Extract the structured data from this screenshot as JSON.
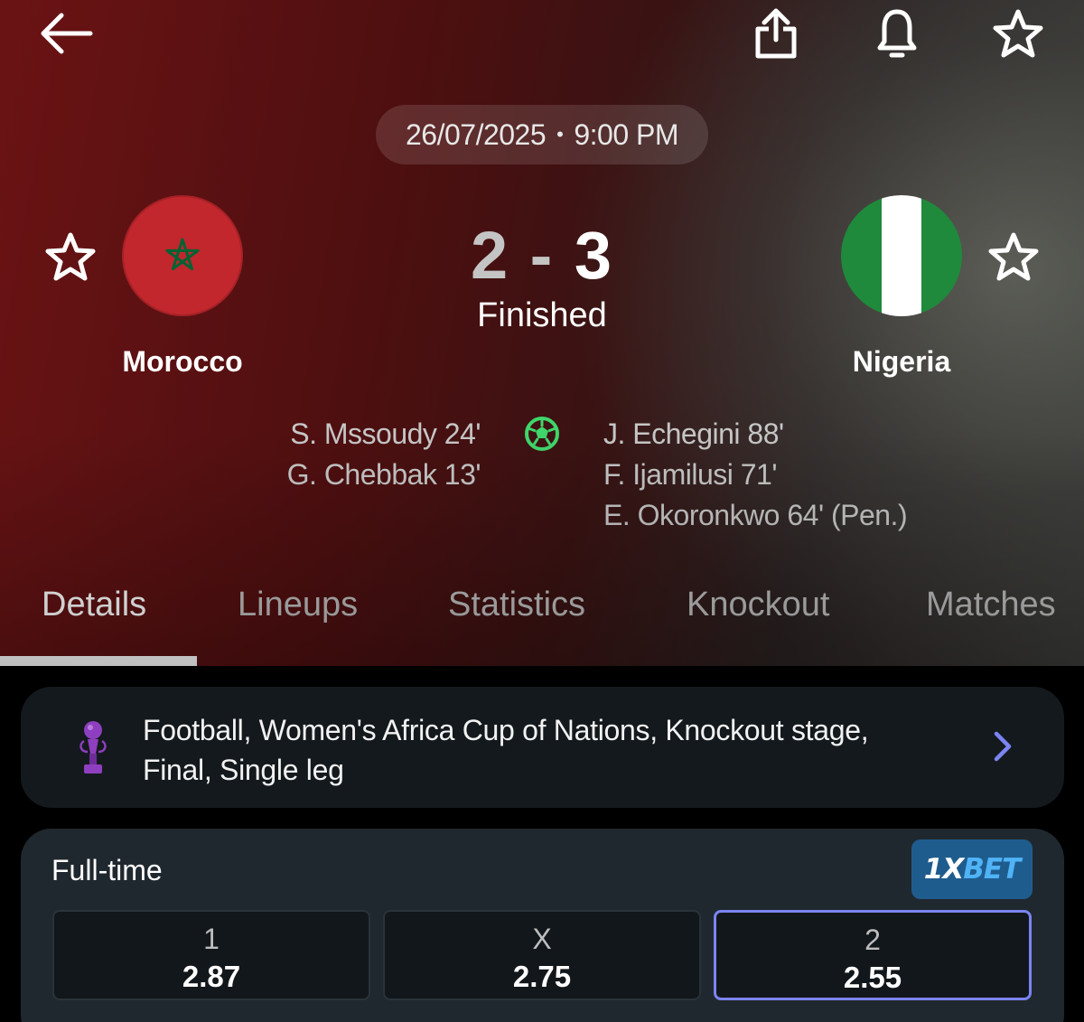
{
  "match": {
    "datetime": "26/07/2025",
    "time": "9:00 PM",
    "separator": "•",
    "home_team": "Morocco",
    "away_team": "Nigeria",
    "home_score": "2",
    "score_separator": "-",
    "away_score": "3",
    "status": "Finished",
    "home_scorers": [
      "S. Mssoudy 24'",
      "G. Chebbak 13'"
    ],
    "away_scorers": [
      "J. Echegini 88'",
      "F. Ijamilusi 71'",
      "E. Okoronkwo 64' (Pen.)"
    ]
  },
  "tabs": [
    "Details",
    "Lineups",
    "Statistics",
    "Knockout",
    "Matches"
  ],
  "active_tab": "Details",
  "competition": {
    "line1": "Football, Women's Africa Cup of Nations, Knockout stage,",
    "line2": "Final, Single leg"
  },
  "odds": {
    "title": "Full-time",
    "bookmaker_a": "1X",
    "bookmaker_b": "BET",
    "options": [
      {
        "label": "1",
        "value": "2.87"
      },
      {
        "label": "X",
        "value": "2.75"
      },
      {
        "label": "2",
        "value": "2.55"
      }
    ]
  },
  "colors": {
    "morocco_red": "#c1272d",
    "morocco_star": "#006233",
    "nigeria_green": "#1f8a3b",
    "accent_purple": "#7b84f2",
    "goal_ball": "#3fd66b",
    "bookmaker_blue": "#1f5c8e"
  },
  "icons": [
    "back-arrow-icon",
    "share-icon",
    "bell-icon",
    "star-icon",
    "soccer-ball-icon",
    "trophy-icon",
    "chevron-right-icon"
  ]
}
